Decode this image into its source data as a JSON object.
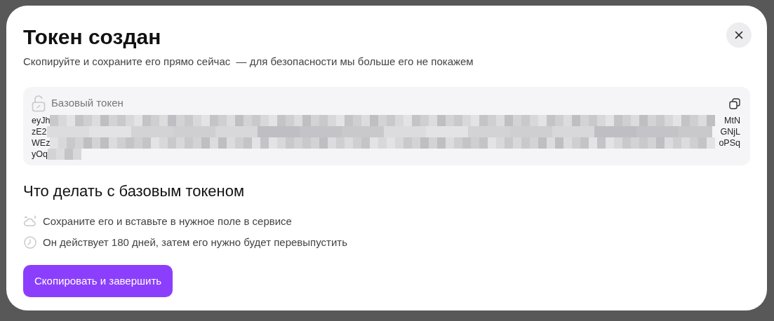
{
  "dialog": {
    "title": "Токен создан",
    "subtitle": "Скопируйте и сохраните его прямо сейчас  — для безопасности мы больше его не покажем"
  },
  "token": {
    "label": "Базовый токен",
    "lines": [
      {
        "kind": "full",
        "start": "eyJh",
        "end": "MtN"
      },
      {
        "kind": "full",
        "start": "zE2",
        "end": "GNjL"
      },
      {
        "kind": "full",
        "start": "WEz",
        "end": "oPSq"
      },
      {
        "kind": "tail",
        "start": "yOq"
      }
    ]
  },
  "section_title": "Что делать с базовым токеном",
  "tips": [
    {
      "kind": "save",
      "text": "Сохраните его и вставьте в нужное поле в сервисе"
    },
    {
      "kind": "clock",
      "text": "Он действует 180 дней, затем его нужно будет перевыпустить"
    }
  ],
  "primary_button": "Скопировать и завершить"
}
